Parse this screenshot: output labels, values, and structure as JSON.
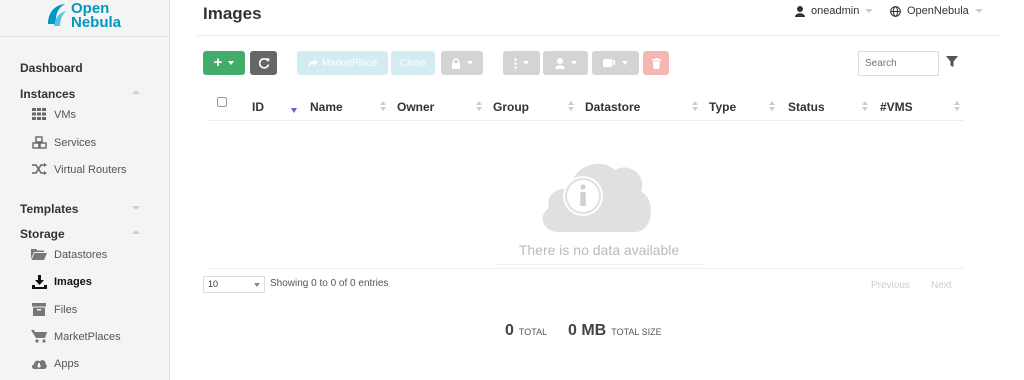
{
  "logo": {
    "line1": "Open",
    "line2": "Nebula"
  },
  "sidebar": {
    "dashboard": "Dashboard",
    "instances": {
      "label": "Instances",
      "items": [
        {
          "label": "VMs",
          "icon": "grid-icon"
        },
        {
          "label": "Services",
          "icon": "cubes-icon"
        },
        {
          "label": "Virtual Routers",
          "icon": "random-icon"
        }
      ]
    },
    "templates": "Templates",
    "storage": {
      "label": "Storage",
      "items": [
        {
          "label": "Datastores",
          "icon": "folder-open-icon"
        },
        {
          "label": "Images",
          "icon": "download-icon"
        },
        {
          "label": "Files",
          "icon": "archive-icon"
        },
        {
          "label": "MarketPlaces",
          "icon": "cart-icon"
        },
        {
          "label": "Apps",
          "icon": "cloud-download-icon"
        }
      ]
    }
  },
  "header": {
    "title": "Images",
    "user": "oneadmin",
    "zone": "OpenNebula"
  },
  "toolbar": {
    "add": "+",
    "refresh_icon": "refresh-icon",
    "marketplace": "MarketPlace",
    "clone": "Clone",
    "search_placeholder": "Search"
  },
  "table": {
    "columns": [
      "ID",
      "Name",
      "Owner",
      "Group",
      "Datastore",
      "Type",
      "Status",
      "#VMS"
    ],
    "empty_message": "There is no data available",
    "page_size": "10",
    "info": "Showing 0 to 0 of 0 entries",
    "previous": "Previous",
    "next": "Next"
  },
  "summary": {
    "total_count": "0",
    "total_label": "TOTAL",
    "size": "0 MB",
    "size_label": "TOTAL SIZE"
  },
  "colors": {
    "brand": "#0098c3",
    "create": "#43ac6a",
    "refresh": "#666666",
    "sort_active": "#6b5ecf"
  }
}
